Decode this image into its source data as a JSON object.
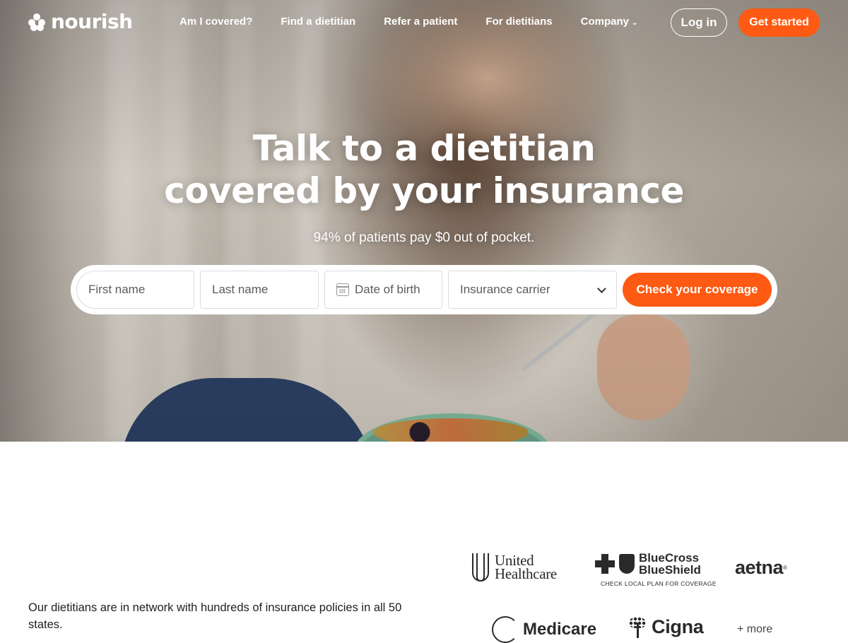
{
  "brand": {
    "name": "nourish",
    "accent_color": "#ff5a13"
  },
  "nav": {
    "links": [
      {
        "label": "Am I covered?"
      },
      {
        "label": "Find a dietitian"
      },
      {
        "label": "Refer a patient"
      },
      {
        "label": "For dietitians"
      },
      {
        "label": "Company",
        "has_dropdown": true
      }
    ],
    "login_label": "Log in",
    "cta_label": "Get started"
  },
  "hero": {
    "title_line1": "Talk to a dietitian",
    "title_line2": "covered by your insurance",
    "subtitle": "94% of patients pay $0 out of pocket."
  },
  "coverage_form": {
    "first_name_placeholder": "First name",
    "last_name_placeholder": "Last name",
    "dob_placeholder": "Date of birth",
    "insurance_placeholder": "Insurance carrier",
    "submit_label": "Check your coverage"
  },
  "network": {
    "description": "Our dietitians are in network with hundreds of insurance policies in all 50 states.",
    "insurers": {
      "united_line1": "United",
      "united_line2": "Healthcare",
      "bcbs_line1": "BlueCross",
      "bcbs_line2": "BlueShield",
      "bcbs_tagline": "CHECK LOCAL PLAN FOR COVERAGE",
      "aetna": "aetna",
      "aetna_mark": "®",
      "medicare": "Medicare",
      "cigna": "Cigna"
    },
    "more_label": "+ more"
  }
}
